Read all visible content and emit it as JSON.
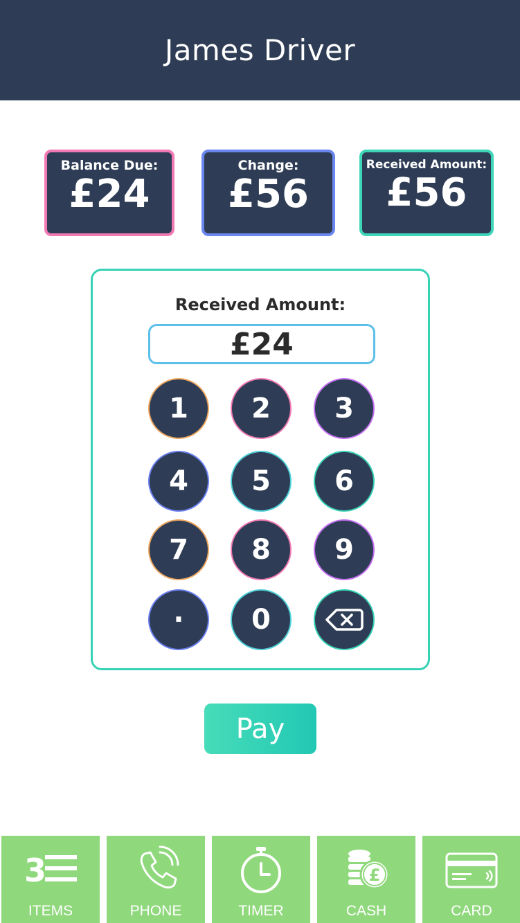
{
  "header": {
    "title": "James Driver"
  },
  "summary": {
    "balance_due": {
      "label": "Balance Due:",
      "value": "£24",
      "border_color": "#f27ab4"
    },
    "change": {
      "label": "Change:",
      "value": "£56",
      "border_color": "#6a87f0"
    },
    "received_amount": {
      "label": "Received Amount:",
      "value": "£56",
      "border_color": "#3ed6b9"
    }
  },
  "keypad": {
    "label": "Received Amount:",
    "input_value": "£24",
    "keys": [
      {
        "label": "1",
        "ring_color": "#f0a860"
      },
      {
        "label": "2",
        "ring_color": "#f27ab4"
      },
      {
        "label": "3",
        "ring_color": "#c36ff0"
      },
      {
        "label": "4",
        "ring_color": "#6a7ff0"
      },
      {
        "label": "5",
        "ring_color": "#4ed0d8"
      },
      {
        "label": "6",
        "ring_color": "#36d2b5"
      },
      {
        "label": "7",
        "ring_color": "#f0a860"
      },
      {
        "label": "8",
        "ring_color": "#f27ab4"
      },
      {
        "label": "9",
        "ring_color": "#c36ff0"
      },
      {
        "label": "·",
        "ring_color": "#6a7ff0"
      },
      {
        "label": "0",
        "ring_color": "#4ed0d8"
      },
      {
        "icon": "backspace-icon",
        "ring_color": "#36d2b5"
      }
    ]
  },
  "pay_button": {
    "label": "Pay"
  },
  "tabbar": {
    "tabs": [
      {
        "label": "ITEMS",
        "icon": "items-list-icon",
        "count": "3"
      },
      {
        "label": "PHONE",
        "icon": "phone-icon"
      },
      {
        "label": "TIMER",
        "icon": "stopwatch-icon"
      },
      {
        "label": "CASH",
        "icon": "coins-pound-icon"
      },
      {
        "label": "CARD",
        "icon": "credit-card-icon"
      }
    ]
  },
  "colors": {
    "navy": "#2e3d55",
    "accent_teal": "#36d2b5",
    "tab_green": "#8fd87c"
  }
}
